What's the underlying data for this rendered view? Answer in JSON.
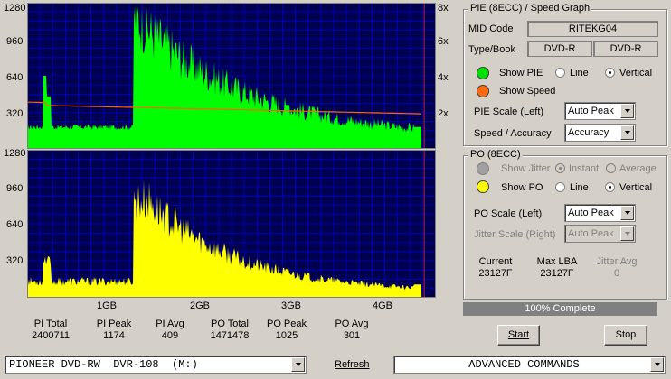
{
  "pie_graph": {
    "y_left_ticks": [
      "1280",
      "960",
      "640",
      "320"
    ],
    "y_right_ticks": [
      "8x",
      "6x",
      "4x",
      "2x"
    ],
    "colors": {
      "background": "#000050",
      "grid": "#0000c8",
      "pie": "#00ff00",
      "speed": "#ff6600",
      "end_marker": "#ff2020"
    }
  },
  "po_graph": {
    "y_left_ticks": [
      "1280",
      "960",
      "640",
      "320"
    ],
    "x_ticks": [
      "1GB",
      "2GB",
      "3GB",
      "4GB"
    ],
    "colors": {
      "background": "#000050",
      "grid": "#0000c8",
      "po": "#ffff00"
    }
  },
  "stats": [
    {
      "label": "PI Total",
      "value": "2400711"
    },
    {
      "label": "PI Peak",
      "value": "1174"
    },
    {
      "label": "PI Avg",
      "value": "409"
    },
    {
      "label": "PO Total",
      "value": "1471478"
    },
    {
      "label": "PO Peak",
      "value": "1025"
    },
    {
      "label": "PO Avg",
      "value": "301"
    }
  ],
  "pie_panel": {
    "title": "PIE (8ECC) / Speed Graph",
    "mid_code_label": "MID Code",
    "mid_code_value": "RITEKG04",
    "type_book_label": "Type/Book",
    "type_value": "DVD-R",
    "book_value": "DVD-R",
    "show_pie": "Show PIE",
    "show_speed": "Show Speed",
    "line": "Line",
    "vertical": "Vertical",
    "pie_scale_label": "PIE Scale (Left)",
    "pie_scale_value": "Auto Peak",
    "speed_label": "Speed / Accuracy",
    "speed_value": "Accuracy"
  },
  "po_panel": {
    "title": "PO (8ECC)",
    "show_jitter": "Show Jitter",
    "instant": "Instant",
    "average": "Average",
    "show_po": "Show PO",
    "line": "Line",
    "vertical": "Vertical",
    "po_scale_label": "PO Scale (Left)",
    "po_scale_value": "Auto Peak",
    "jitter_scale_label": "Jitter Scale (Right)",
    "jitter_scale_value": "Auto Peak",
    "current_label": "Current",
    "current_value": "23127F",
    "maxlba_label": "Max LBA",
    "maxlba_value": "23127F",
    "jitter_avg_label": "Jitter Avg",
    "jitter_avg_value": "0"
  },
  "progress": {
    "text": "100% Complete",
    "fraction": 1.0
  },
  "buttons": {
    "start": "Start",
    "stop": "Stop",
    "refresh": "Refresh"
  },
  "drive": {
    "value": "PIONEER DVD-RW  DVR-108  (M:)"
  },
  "advanced": {
    "value": "ADVANCED COMMANDS"
  }
}
